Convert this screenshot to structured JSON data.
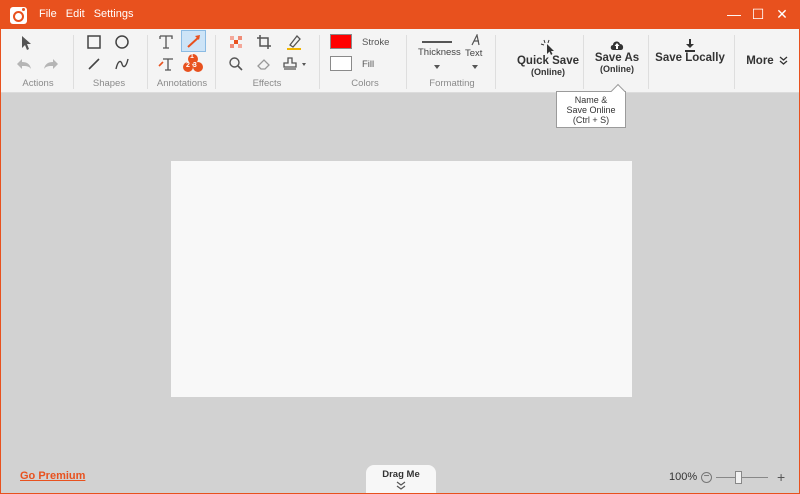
{
  "app": {
    "menu": [
      "File",
      "Edit",
      "Settings"
    ],
    "brand_color": "#e8511e"
  },
  "window_controls": {
    "minimize_glyph": "—",
    "maximize_glyph": "☐",
    "close_glyph": "✕"
  },
  "toolbar": {
    "groups": {
      "actions": "Actions",
      "shapes": "Shapes",
      "annotations": "Annotations",
      "effects": "Effects",
      "colors": "Colors",
      "formatting": "Formatting"
    },
    "colors": {
      "stroke_label": "Stroke",
      "fill_label": "Fill",
      "stroke_color": "#ff0000",
      "fill_color": "#ffffff"
    },
    "formatting": {
      "thickness_label": "Thickness",
      "text_label": "Text"
    },
    "annotation_step_badge": "1",
    "annotation_step_badge_row": "23",
    "quick_save": {
      "label": "Quick Save",
      "sub": "(Online)"
    },
    "save_as": {
      "label": "Save As",
      "sub": "(Online)"
    },
    "save_locally": {
      "label": "Save Locally"
    },
    "more": {
      "label": "More"
    }
  },
  "tooltip": {
    "line1": "Name &",
    "line2": "Save Online",
    "line3": "(Ctrl + S)"
  },
  "footer": {
    "go_premium": "Go Premium",
    "drag_me": "Drag Me",
    "zoom": "100%",
    "zoom_level": 0.42
  }
}
